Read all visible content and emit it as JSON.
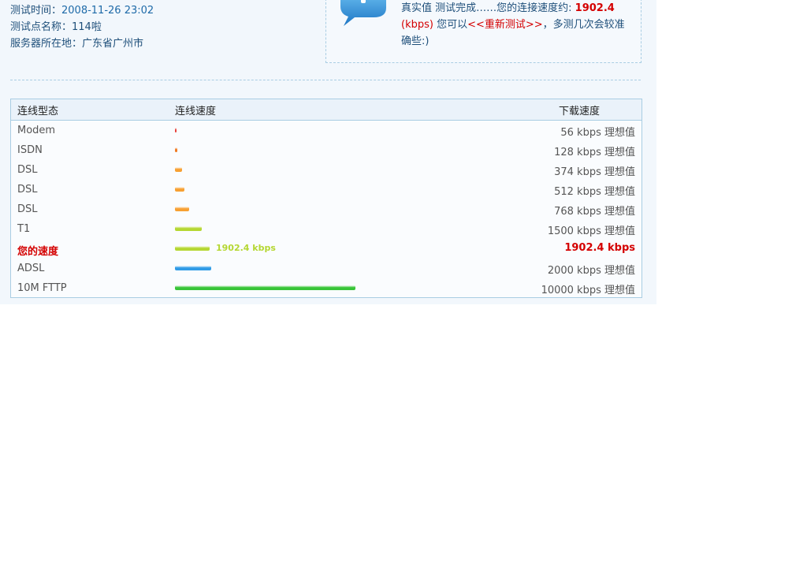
{
  "test_info": {
    "time_label": "测试时间：",
    "time_value": "2008-11-26 23:02",
    "node_label": "测试点名称：",
    "node_value": "114啦",
    "server_label": "服务器所在地：",
    "server_value": "广东省广州市"
  },
  "notice": {
    "icon": "info-icon",
    "prefix": "真实值  测试完成……您的连接速度约: ",
    "speed": "1902.4",
    "unit": "(kbps)",
    "middle": " 您可以",
    "retest_link": "<<重新测试>>",
    "suffix": "，多测几次会较准确些:)"
  },
  "table": {
    "headers": {
      "type": "连线型态",
      "speed": "连线速度",
      "download": "下载速度"
    },
    "rows": [
      {
        "type": "Modem",
        "kbps": 56,
        "download": "56 kbps 理想值",
        "color": "#e8413a",
        "highlight": false
      },
      {
        "type": "ISDN",
        "kbps": 128,
        "download": "128 kbps 理想值",
        "color": "#f07a22",
        "highlight": false
      },
      {
        "type": "DSL",
        "kbps": 374,
        "download": "374 kbps 理想值",
        "color": "#f7a032",
        "highlight": false
      },
      {
        "type": "DSL",
        "kbps": 512,
        "download": "512 kbps 理想值",
        "color": "#f7a032",
        "highlight": false
      },
      {
        "type": "DSL",
        "kbps": 768,
        "download": "768 kbps 理想值",
        "color": "#f7a032",
        "highlight": false
      },
      {
        "type": "T1",
        "kbps": 1500,
        "download": "1500 kbps 理想值",
        "color": "#b5d732",
        "highlight": false
      },
      {
        "type": "您的速度",
        "kbps": 1902.4,
        "download": "1902.4 kbps",
        "bar_label": "1902.4 kbps",
        "color": "#b5d732",
        "highlight": true
      },
      {
        "type": "ADSL",
        "kbps": 2000,
        "download": "2000 kbps 理想值",
        "color": "#2f9be6",
        "highlight": false
      },
      {
        "type": "10M FTTP",
        "kbps": 10000,
        "download": "10000 kbps 理想值",
        "color": "#37c437",
        "highlight": false
      }
    ]
  }
}
